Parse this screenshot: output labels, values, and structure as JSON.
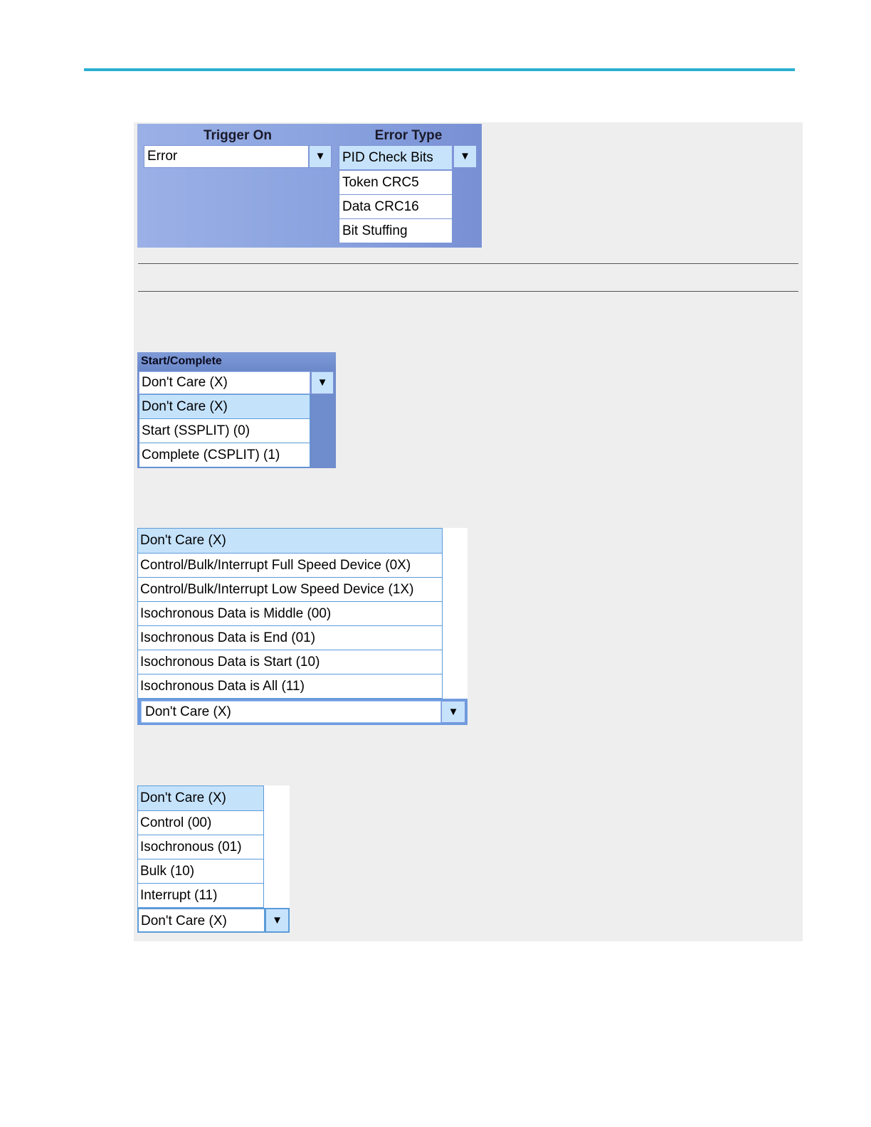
{
  "trigger_panel": {
    "trigger_on_header": "Trigger On",
    "error_type_header": "Error Type",
    "trigger_on_value": "Error",
    "error_type_value": "PID Check Bits",
    "error_type_options": [
      "Token CRC5",
      "Data CRC16",
      "Bit Stuffing"
    ]
  },
  "start_complete": {
    "header": "Start/Complete",
    "value": "Don't Care (X)",
    "options": [
      "Don't Care (X)",
      "Start (SSPLIT) (0)",
      "Complete (CSPLIT) (1)"
    ]
  },
  "speed_list": {
    "options": [
      "Don't Care (X)",
      "Control/Bulk/Interrupt Full Speed Device (0X)",
      "Control/Bulk/Interrupt Low Speed Device (1X)",
      "Isochronous Data is Middle (00)",
      "Isochronous Data is End (01)",
      "Isochronous Data is Start (10)",
      "Isochronous Data is All (11)"
    ],
    "value": "Don't Care (X)"
  },
  "endpoint_type_list": {
    "options": [
      "Don't Care (X)",
      "Control (00)",
      "Isochronous (01)",
      "Bulk (10)",
      "Interrupt (11)"
    ],
    "value": "Don't Care (X)"
  },
  "icons": {
    "dropdown": "chevron-down-icon"
  },
  "colors": {
    "accent_rule": "#2ab0d0",
    "panel_blue": "#8aa3df",
    "selection": "#c7e3fb"
  }
}
